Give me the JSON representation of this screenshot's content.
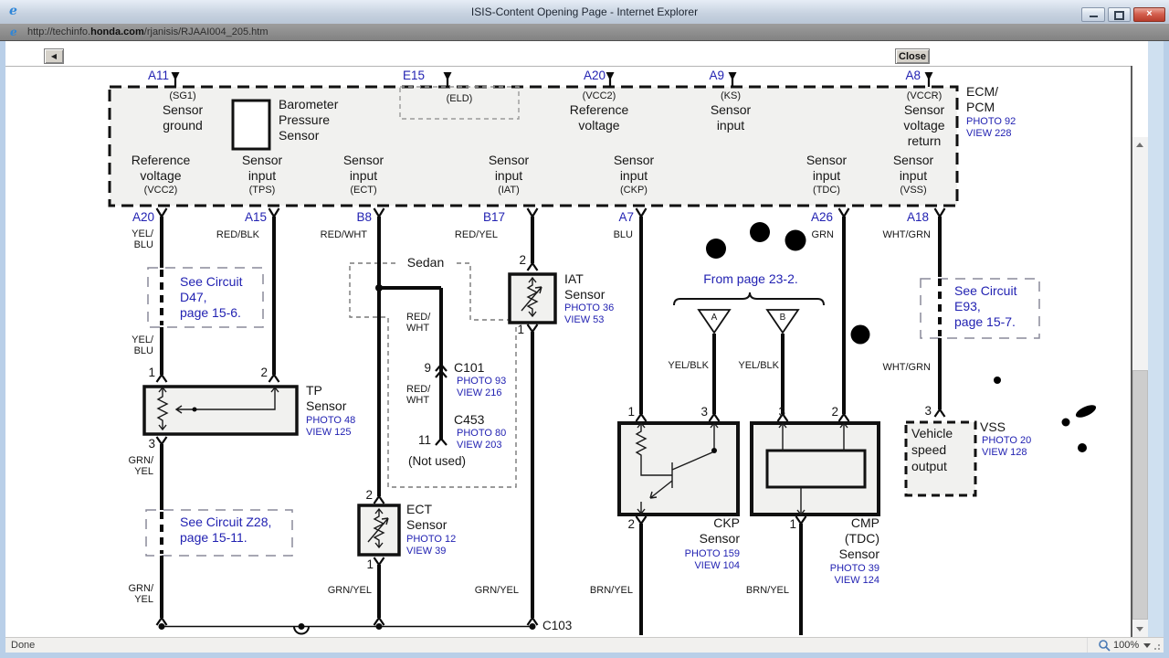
{
  "window": {
    "title": "ISIS-Content Opening Page - Internet Explorer",
    "close_glyph": "×"
  },
  "address": {
    "url_pre": "http://techinfo.",
    "url_domain": "honda.com",
    "url_post": "/rjanisis/RJAAI004_205.htm"
  },
  "toolbar": {
    "back": "◀",
    "close": "Close"
  },
  "statusbar": {
    "status": "Done",
    "zoom": "100%"
  },
  "diagram": {
    "top_pins": [
      "A11",
      "E15",
      "A20",
      "A9",
      "A8"
    ],
    "bottom_pins": [
      "A20",
      "A15",
      "B8",
      "B17",
      "A7",
      "A26",
      "A18"
    ],
    "ecm": {
      "name1": "ECM/",
      "name2": "PCM",
      "photo": "PHOTO 92",
      "view": "VIEW 228",
      "sg1": [
        "(SG1)",
        "Sensor",
        "ground"
      ],
      "baro": [
        "Barometer",
        "Pressure",
        "Sensor"
      ],
      "eld": "(ELD)",
      "vcc2_top": [
        "(VCC2)",
        "Reference",
        "voltage"
      ],
      "ks": [
        "(KS)",
        "Sensor",
        "input"
      ],
      "vccr": [
        "(VCCR)",
        "Sensor",
        "voltage",
        "return"
      ],
      "cells": [
        [
          "Reference",
          "voltage",
          "(VCC2)"
        ],
        [
          "Sensor",
          "input",
          "(TPS)"
        ],
        [
          "Sensor",
          "input",
          "(ECT)"
        ],
        [
          "Sensor",
          "input",
          "(IAT)"
        ],
        [
          "Sensor",
          "input",
          "(CKP)"
        ],
        [
          "Sensor",
          "input",
          "(TDC)"
        ],
        [
          "Sensor",
          "input",
          "(VSS)"
        ]
      ]
    },
    "wl": {
      "yel": "YEL/",
      "blu": "BLU",
      "grn_s": "GRN/",
      "yel_s": "YEL",
      "redblk": "RED/BLK",
      "redwht": "RED/WHT",
      "redyel": "RED/YEL",
      "red": "RED/",
      "wht": "WHT",
      "grn": "GRN",
      "whtgrn": "WHT/GRN",
      "grnyel": "GRN/YEL",
      "brnyel": "BRN/YEL",
      "yelblk": "YEL/BLK"
    },
    "pins": {
      "p1": "1",
      "p2": "2",
      "p3": "3",
      "p9": "9",
      "p11": "11"
    },
    "tp": {
      "name": "TP",
      "type": "Sensor",
      "photo": "PHOTO 48",
      "view": "VIEW 125"
    },
    "iat": {
      "name": "IAT",
      "type": "Sensor",
      "photo": "PHOTO 36",
      "view": "VIEW 53"
    },
    "ect": {
      "name": "ECT",
      "type": "Sensor",
      "photo": "PHOTO 12",
      "view": "VIEW 39"
    },
    "ckp": {
      "name": "CKP",
      "type": "Sensor",
      "photo": "PHOTO 159",
      "view": "VIEW 104"
    },
    "cmp": {
      "name": "CMP",
      "sub": "(TDC)",
      "type": "Sensor",
      "photo": "PHOTO 39",
      "view": "VIEW 124"
    },
    "vss": {
      "body": [
        "Vehicle",
        "speed",
        "output"
      ],
      "name": "VSS",
      "photo": "PHOTO 20",
      "view": "VIEW 128"
    },
    "c101": {
      "name": "C101",
      "photo": "PHOTO 93",
      "view": "VIEW 216"
    },
    "c453": {
      "name": "C453",
      "photo": "PHOTO 80",
      "view": "VIEW 203"
    },
    "c103": "C103",
    "not_used": "(Not used)",
    "sedan": "Sedan",
    "from_page": "From page 23-2.",
    "tri": {
      "a": "A",
      "b": "B"
    },
    "see_d47": [
      "See Circuit",
      "D47,",
      "page 15-6."
    ],
    "see_z28": [
      "See Circuit Z28,",
      "page 15-11."
    ],
    "see_e93": [
      "See Circuit",
      "E93,",
      "page 15-7."
    ]
  }
}
